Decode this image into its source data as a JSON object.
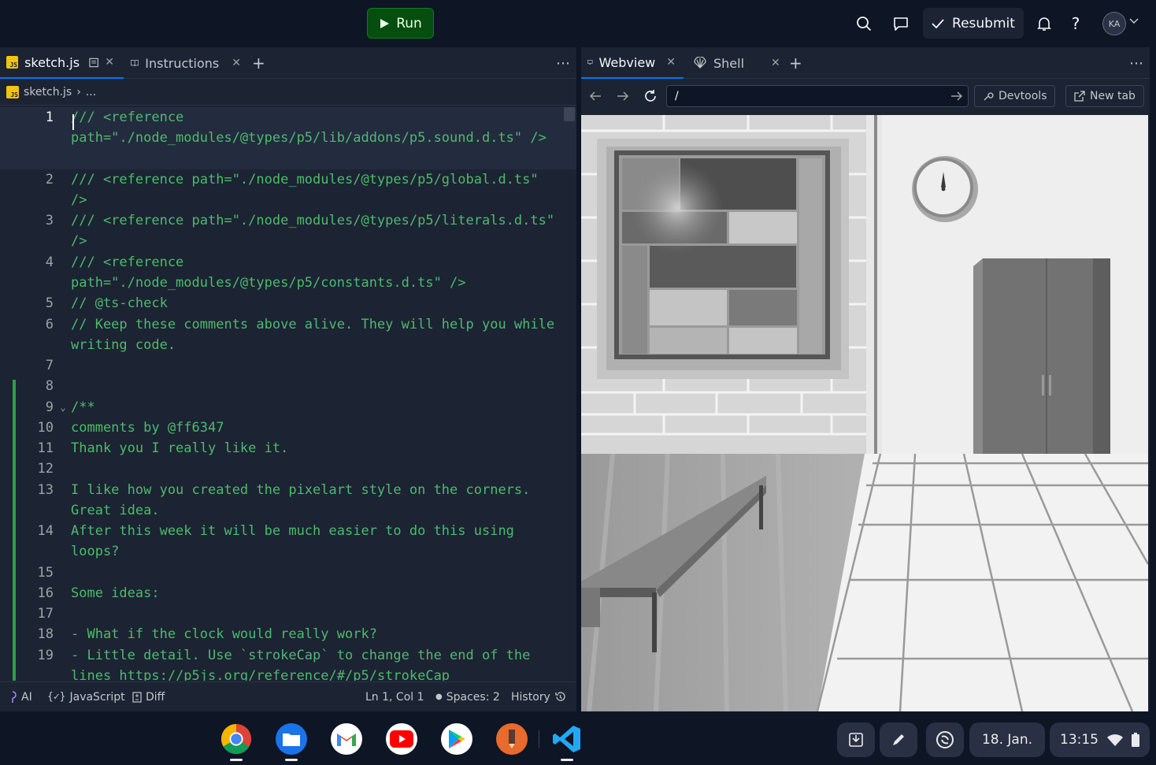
{
  "topbar": {
    "run_label": "Run",
    "resubmit_label": "Resubmit",
    "avatar_initials": "KA",
    "icons": [
      "search-icon",
      "chat-icon",
      "check-icon",
      "bell-icon",
      "help-icon",
      "chevron-down-icon"
    ]
  },
  "editor": {
    "tabs": [
      {
        "label": "sketch.js",
        "icon": "js-file-icon"
      },
      {
        "label": "Instructions",
        "icon": "book-icon"
      }
    ],
    "breadcrumb": {
      "file": "sketch.js",
      "rest": "..."
    },
    "lines": [
      {
        "n": "1",
        "text": "/// <reference path=\"./node_modules/@types/p5/lib/addons/p5.sound.d.ts\" />"
      },
      {
        "n": "2",
        "text": "/// <reference path=\"./node_modules/@types/p5/global.d.ts\" />"
      },
      {
        "n": "3",
        "text": "/// <reference path=\"./node_modules/@types/p5/literals.d.ts\" />"
      },
      {
        "n": "4",
        "text": "/// <reference path=\"./node_modules/@types/p5/constants.d.ts\" />"
      },
      {
        "n": "5",
        "text": "// @ts-check"
      },
      {
        "n": "6",
        "text": "// Keep these comments above alive. They will help you while writing code."
      },
      {
        "n": "7",
        "text": ""
      },
      {
        "n": "8",
        "text": ""
      },
      {
        "n": "9",
        "text": "/**"
      },
      {
        "n": "10",
        "text": "comments by @ff6347"
      },
      {
        "n": "11",
        "text": "Thank you I really like it."
      },
      {
        "n": "12",
        "text": ""
      },
      {
        "n": "13",
        "text": "I like how you created the pixelart style on the corners. Great idea."
      },
      {
        "n": "14",
        "text": "After this week it will be much easier to do this using loops?"
      },
      {
        "n": "15",
        "text": ""
      },
      {
        "n": "16",
        "text": "Some ideas:"
      },
      {
        "n": "17",
        "text": ""
      },
      {
        "n": "18",
        "text": "- What if the clock would really work?"
      },
      {
        "n": "19",
        "text": "- Little detail. Use `strokeCap` to change the end of the lines https://p5js.org/reference/#/p5/strokeCap"
      }
    ],
    "status": {
      "ai": "AI",
      "language": "JavaScript",
      "diff": "Diff",
      "position": "Ln 1, Col 1",
      "spaces": "Spaces: 2",
      "history": "History"
    }
  },
  "webview": {
    "tabs": [
      {
        "label": "Webview",
        "icon": "monitor-icon"
      },
      {
        "label": "Shell",
        "icon": "shell-icon"
      }
    ],
    "url": "/",
    "devtools_label": "Devtools",
    "newtab_label": "New tab"
  },
  "shelf": {
    "apps": [
      "chrome",
      "files",
      "gmail",
      "youtube",
      "play-store",
      "sketchbook",
      "vscode"
    ],
    "date": "18. Jan.",
    "time": "13:15"
  }
}
